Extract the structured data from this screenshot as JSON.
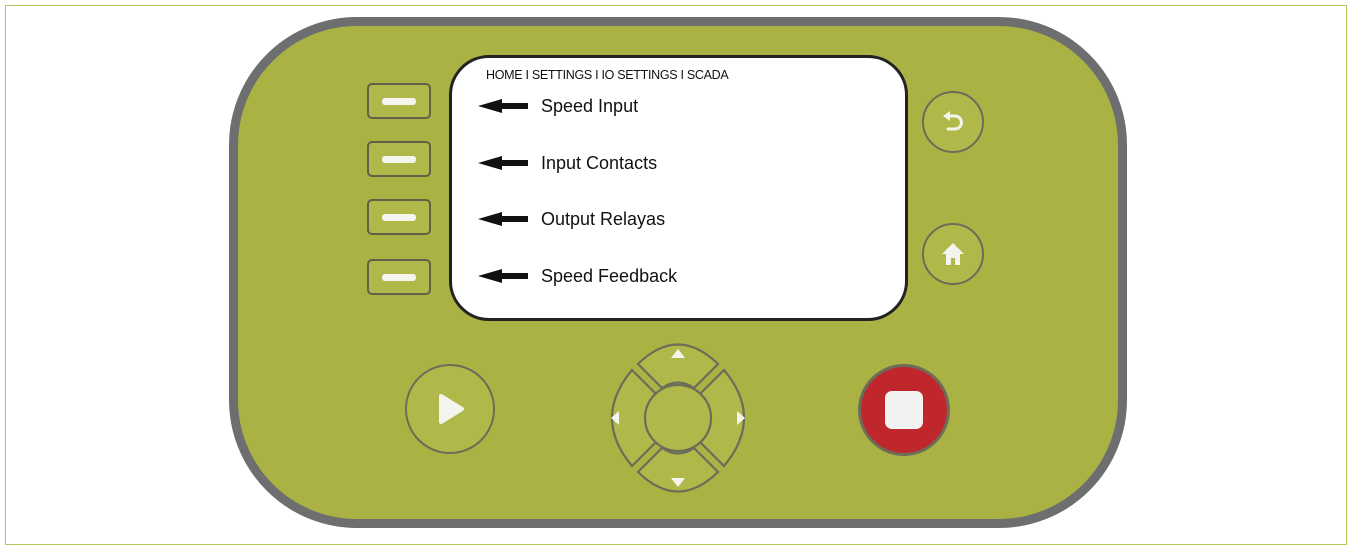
{
  "colors": {
    "body": "#aab243",
    "bezel": "#6d6e70",
    "stop": "#c0272d",
    "screen": "#ffffff"
  },
  "screen": {
    "breadcrumb": "HOME I SETTINGS I IO SETTINGS I SCADA",
    "items": [
      {
        "label": "Speed Input"
      },
      {
        "label": "Input Contacts"
      },
      {
        "label": "Output Relayas"
      },
      {
        "label": "Speed Feedback"
      }
    ]
  },
  "icons": {
    "back": "undo-arrow-icon",
    "home": "house-icon",
    "play": "play-triangle-icon",
    "stop": "stop-square-icon",
    "up": "triangle-up-icon",
    "down": "triangle-down-icon",
    "left": "triangle-left-icon",
    "right": "triangle-right-icon"
  }
}
